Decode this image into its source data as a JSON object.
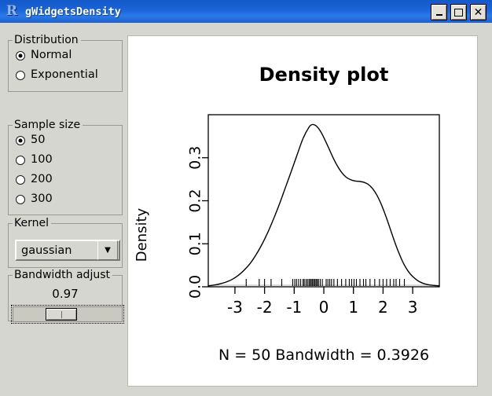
{
  "window": {
    "title": "gWidgetsDensity",
    "icon": "r-logo-icon",
    "buttons": {
      "minimize": "minimize",
      "maximize": "maximize",
      "close": "close"
    }
  },
  "controls": {
    "distribution": {
      "legend": "Distribution",
      "options": [
        {
          "label": "Normal",
          "selected": true
        },
        {
          "label": "Exponential",
          "selected": false
        }
      ]
    },
    "sample_size": {
      "legend": "Sample size",
      "options": [
        {
          "label": "50",
          "selected": true
        },
        {
          "label": "100",
          "selected": false
        },
        {
          "label": "200",
          "selected": false
        },
        {
          "label": "300",
          "selected": false
        }
      ]
    },
    "kernel": {
      "legend": "Kernel",
      "value": "gaussian",
      "arrow": "chevron-down-icon"
    },
    "bandwidth": {
      "legend": "Bandwidth adjust",
      "value": "0.97",
      "thumb_position_pct": 43
    }
  },
  "chart_data": {
    "type": "line",
    "title": "Density plot",
    "xlabel": "",
    "ylabel": "Density",
    "subtitle": "N = 50   Bandwidth = 0.3926",
    "n": 50,
    "bandwidth": 0.3926,
    "grid": false,
    "legend": "none",
    "xlim": [
      -3.9,
      3.9
    ],
    "ylim": [
      0,
      0.4
    ],
    "xticks": [
      -3,
      -2,
      -1,
      0,
      1,
      2,
      3
    ],
    "yticks": [
      0.0,
      0.1,
      0.2,
      0.3
    ],
    "ytick_labels": [
      "0.0",
      "0.1",
      "0.2",
      "0.3"
    ],
    "xtick_labels": [
      "-3",
      "-2",
      "-1",
      "0",
      "1",
      "2",
      "3"
    ],
    "series": [
      {
        "name": "density",
        "x": [
          -3.9,
          -3.7,
          -3.5,
          -3.3,
          -3.1,
          -2.9,
          -2.7,
          -2.5,
          -2.3,
          -2.1,
          -1.9,
          -1.7,
          -1.5,
          -1.3,
          -1.1,
          -0.9,
          -0.7,
          -0.5,
          -0.4,
          -0.3,
          -0.2,
          -0.1,
          0.0,
          0.15,
          0.3,
          0.45,
          0.6,
          0.75,
          0.9,
          1.05,
          1.2,
          1.35,
          1.5,
          1.65,
          1.8,
          1.95,
          2.1,
          2.25,
          2.4,
          2.55,
          2.7,
          2.85,
          3.0,
          3.2,
          3.4,
          3.6,
          3.9
        ],
        "y": [
          0.002,
          0.004,
          0.007,
          0.011,
          0.017,
          0.026,
          0.038,
          0.053,
          0.073,
          0.097,
          0.125,
          0.157,
          0.192,
          0.23,
          0.268,
          0.307,
          0.345,
          0.371,
          0.377,
          0.376,
          0.37,
          0.36,
          0.347,
          0.325,
          0.302,
          0.282,
          0.266,
          0.255,
          0.249,
          0.246,
          0.245,
          0.243,
          0.238,
          0.228,
          0.212,
          0.19,
          0.163,
          0.133,
          0.103,
          0.076,
          0.053,
          0.036,
          0.024,
          0.013,
          0.007,
          0.004,
          0.002
        ]
      }
    ],
    "rug": {
      "name": "rug-marks",
      "values": [
        -2.62,
        -2.18,
        -2.0,
        -1.78,
        -1.42,
        -1.05,
        -0.98,
        -0.92,
        -0.85,
        -0.78,
        -0.7,
        -0.66,
        -0.6,
        -0.55,
        -0.5,
        -0.46,
        -0.42,
        -0.38,
        -0.34,
        -0.3,
        -0.26,
        -0.22,
        -0.18,
        -0.12,
        -0.05,
        0.08,
        0.14,
        0.2,
        0.26,
        0.34,
        0.46,
        0.6,
        0.74,
        0.86,
        0.94,
        1.02,
        1.1,
        1.22,
        1.34,
        1.42,
        1.56,
        1.72,
        1.88,
        2.0,
        2.12,
        2.24,
        2.36,
        2.44,
        2.56,
        2.72
      ]
    },
    "colors": {
      "line": "#000000",
      "axis": "#000000",
      "background": "#ffffff"
    }
  }
}
